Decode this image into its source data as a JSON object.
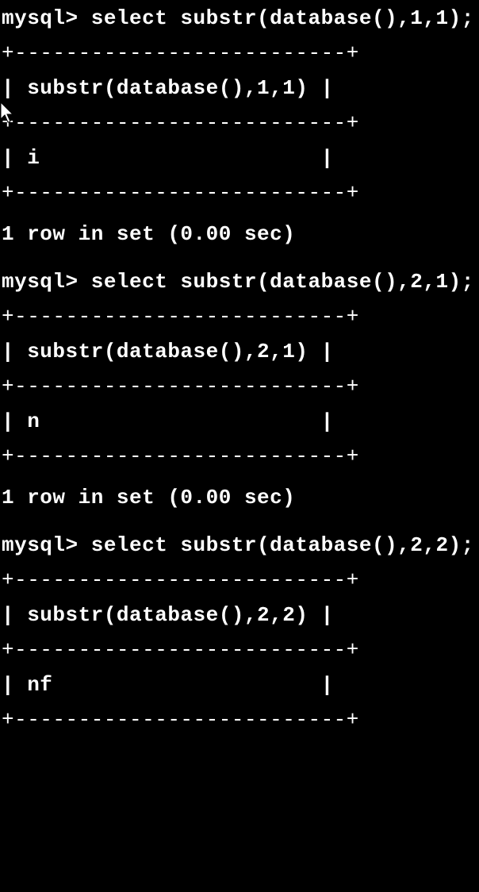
{
  "queries": [
    {
      "prompt": "mysql> select substr(database(),1,1);",
      "sep": "+--------------------------+",
      "header": "| substr(database(),1,1) |",
      "data": "| i                      |",
      "status": "1 row in set (0.00 sec)"
    },
    {
      "prompt": "mysql> select substr(database(),2,1);",
      "sep": "+--------------------------+",
      "header": "| substr(database(),2,1) |",
      "data": "| n                      |",
      "status": "1 row in set (0.00 sec)"
    },
    {
      "prompt": "mysql> select substr(database(),2,2);",
      "sep": "+--------------------------+",
      "header": "| substr(database(),2,2) |",
      "data": "| nf                     |"
    }
  ]
}
